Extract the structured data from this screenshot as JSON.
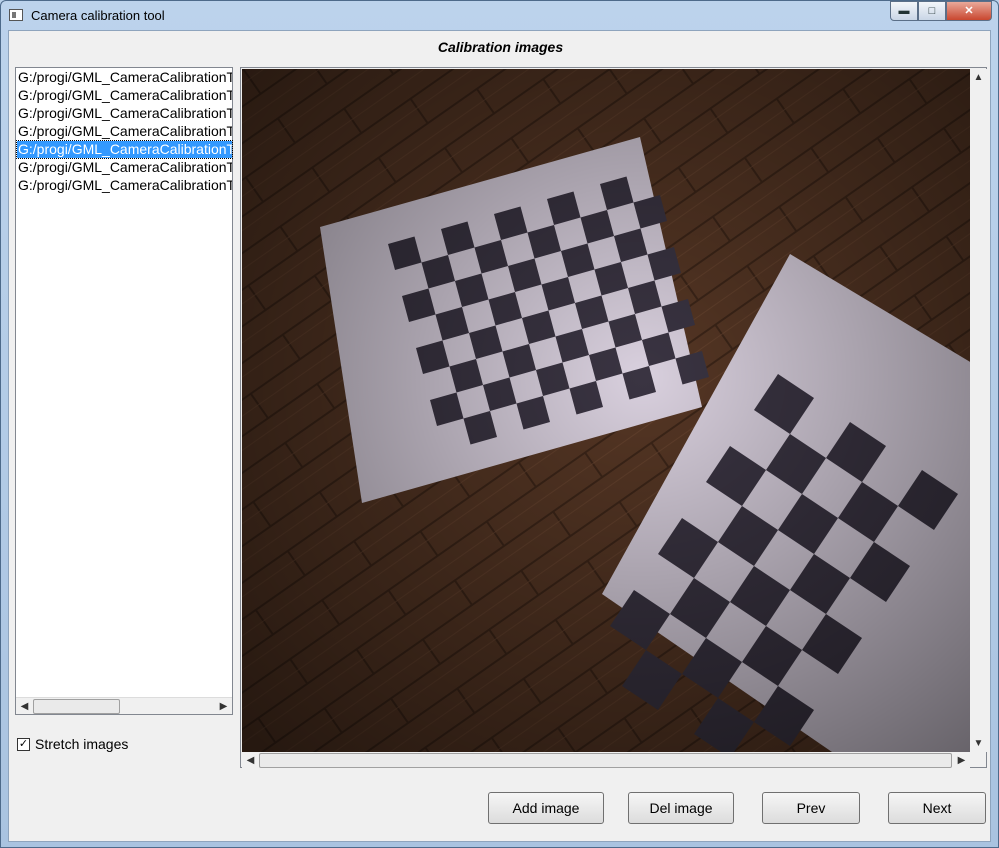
{
  "window": {
    "title": "Camera calibration tool"
  },
  "window_controls": {
    "minimize": "▬",
    "maximize": "□",
    "close": "✕"
  },
  "section": {
    "title": "Calibration images"
  },
  "file_list": {
    "items": [
      "G:/progi/GML_CameraCalibrationT",
      "G:/progi/GML_CameraCalibrationT",
      "G:/progi/GML_CameraCalibrationT",
      "G:/progi/GML_CameraCalibrationT",
      "G:/progi/GML_CameraCalibrationT",
      "G:/progi/GML_CameraCalibrationT",
      "G:/progi/GML_CameraCalibrationT"
    ],
    "selected_index": 4
  },
  "options": {
    "stretch_images_label": "Stretch images",
    "stretch_images_checked": true,
    "check_mark": "✓"
  },
  "scrollbar_glyphs": {
    "left": "◀",
    "right": "▶",
    "up": "▲",
    "down": "▼"
  },
  "buttons": {
    "add_image": "Add image",
    "del_image": "Del image",
    "prev": "Prev",
    "next": "Next"
  },
  "colors": {
    "selection": "#3399ff",
    "floor": "#4a2f20",
    "paper": "#d8cfdc",
    "checker": "#3a3442"
  }
}
